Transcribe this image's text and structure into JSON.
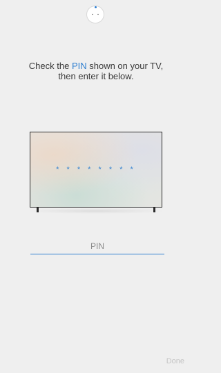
{
  "instructions": {
    "line1_prefix": "Check the ",
    "line1_accent": "PIN",
    "line1_suffix": " shown on your TV,",
    "line2": "then enter it below."
  },
  "tv": {
    "pin_mask": "* * * * * * * *"
  },
  "pin_input": {
    "value": "",
    "placeholder": "PIN"
  },
  "footer": {
    "done_label": "Done"
  },
  "colors": {
    "accent": "#2f7fd0",
    "background": "#efefef",
    "disabled_text": "#c4c4c4"
  },
  "icons": {
    "top": "device-connect-icon"
  }
}
